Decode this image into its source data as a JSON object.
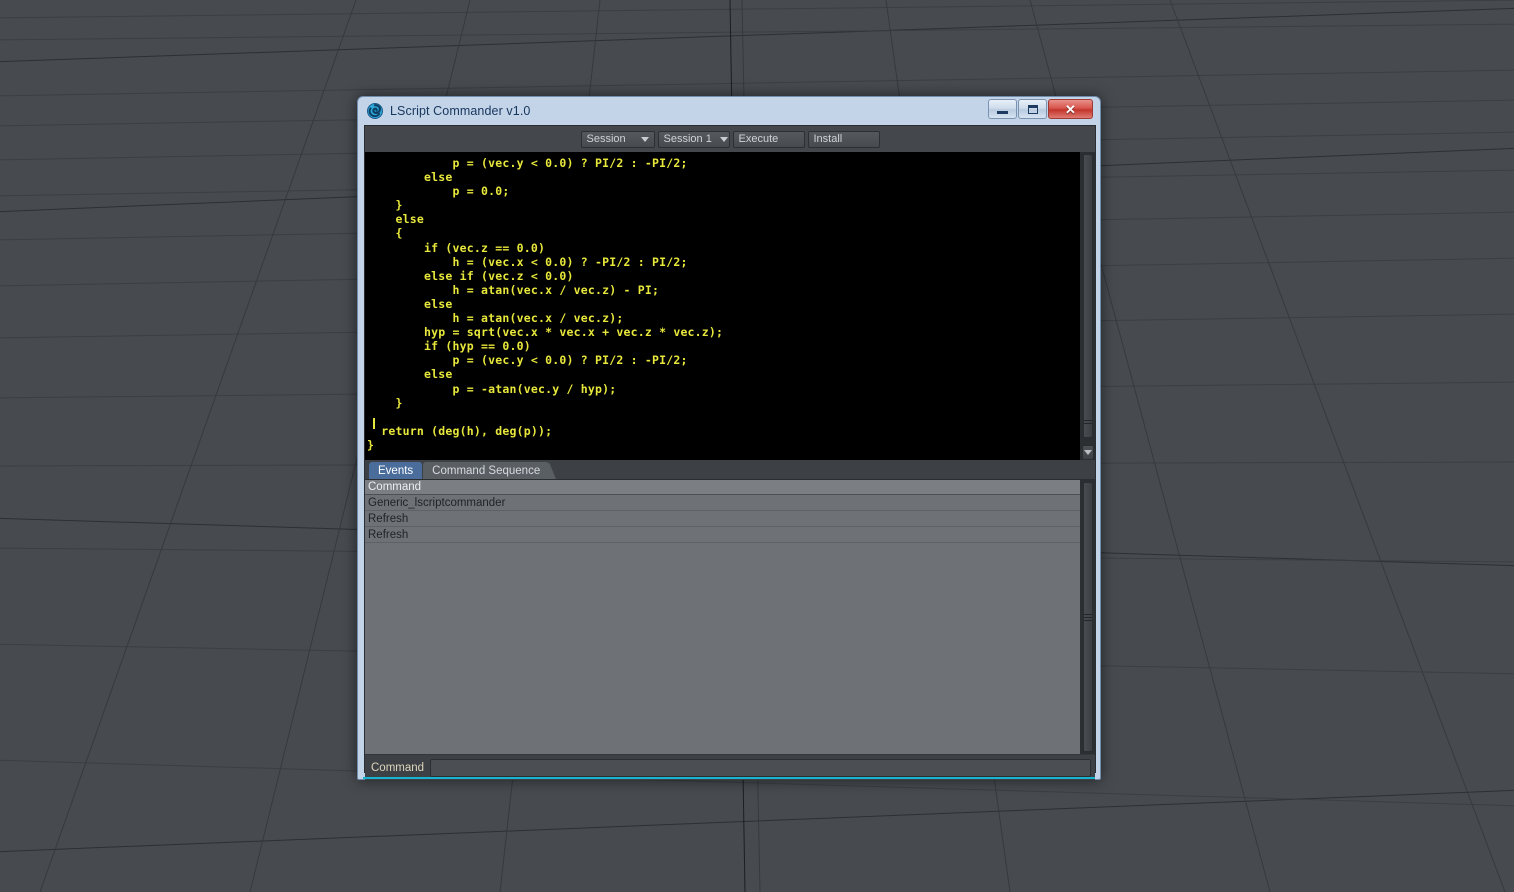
{
  "window": {
    "title": "LScript Commander v1.0",
    "app_icon": "lightwave-swirl-icon",
    "controls": {
      "minimize_label": "Minimize",
      "maximize_label": "Maximize",
      "close_label": "Close",
      "close_glyph": "✕"
    }
  },
  "toolbar": {
    "session_dropdown": "Session",
    "session_select": "Session 1",
    "execute_label": "Execute",
    "install_label": "Install"
  },
  "editor": {
    "language": "LScript",
    "text_color": "#e8e83c",
    "background": "#000000",
    "code": "            p = (vec.y < 0.0) ? PI/2 : -PI/2;\n        else\n            p = 0.0;\n    }\n    else\n    {\n        if (vec.z == 0.0)\n            h = (vec.x < 0.0) ? -PI/2 : PI/2;\n        else if (vec.z < 0.0)\n            h = atan(vec.x / vec.z) - PI;\n        else\n            h = atan(vec.x / vec.z);\n        hyp = sqrt(vec.x * vec.x + vec.z * vec.z);\n        if (hyp == 0.0)\n            p = (vec.y < 0.0) ? PI/2 : -PI/2;\n        else\n            p = -atan(vec.y / hyp);\n    }\n\n  return (deg(h), deg(p));\n}"
  },
  "tabs": [
    {
      "label": "Events",
      "active": true
    },
    {
      "label": "Command Sequence",
      "active": false
    }
  ],
  "list": {
    "columns": [
      "Command"
    ],
    "rows": [
      [
        "Generic_lscriptcommander"
      ],
      [
        "Refresh"
      ],
      [
        "Refresh"
      ]
    ]
  },
  "command_bar": {
    "label": "Command",
    "value": "",
    "placeholder": ""
  },
  "scrollbars": {
    "editor_vertical": {
      "name": "editor-vscrollbar",
      "thumb_grip": "grip-lines",
      "arrow": "chevron-down-icon"
    },
    "list_vertical": {
      "name": "list-vscrollbar",
      "thumb_grip": "grip-lines"
    }
  },
  "viewport": {
    "background_color": "#474b4f",
    "grid_line_color": "#2f3236",
    "description": "LightWave perspective floor grid"
  }
}
